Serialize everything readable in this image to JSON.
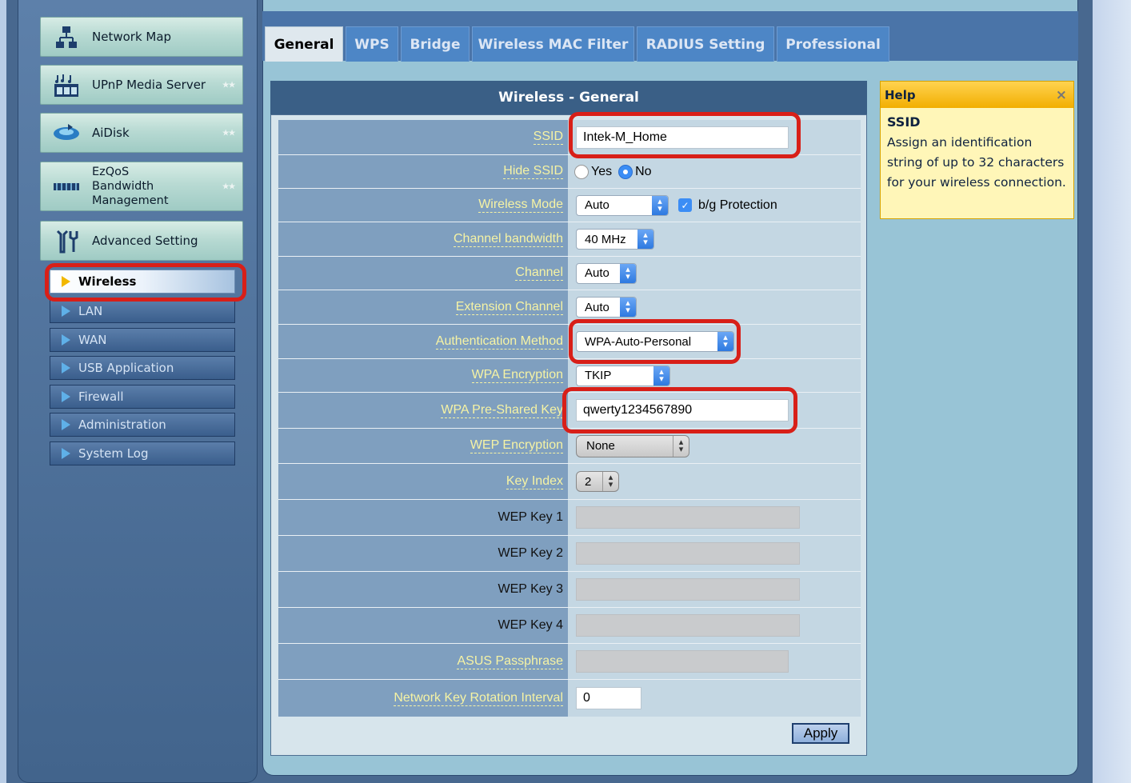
{
  "sidebar": {
    "main_items": [
      {
        "label": "Network Map",
        "icon": "network-map-icon"
      },
      {
        "label": "UPnP Media Server",
        "icon": "media-server-icon"
      },
      {
        "label": "AiDisk",
        "icon": "aidisk-icon"
      },
      {
        "label": "EzQoS\nBandwidth\nManagement",
        "icon": "qos-icon"
      },
      {
        "label": "Advanced Setting",
        "icon": "tools-icon"
      }
    ],
    "sub_items": [
      {
        "label": "Wireless",
        "active": true
      },
      {
        "label": "LAN"
      },
      {
        "label": "WAN"
      },
      {
        "label": "USB Application"
      },
      {
        "label": "Firewall"
      },
      {
        "label": "Administration"
      },
      {
        "label": "System Log"
      }
    ]
  },
  "tabs": [
    "General",
    "WPS",
    "Bridge",
    "Wireless MAC Filter",
    "RADIUS Setting",
    "Professional"
  ],
  "active_tab": "General",
  "form": {
    "title": "Wireless - General",
    "ssid_label": "SSID",
    "ssid_value": "Intek-M_Home",
    "hide_ssid_label": "Hide SSID",
    "hide_ssid_yes": "Yes",
    "hide_ssid_no": "No",
    "hide_ssid_selected": "No",
    "wireless_mode_label": "Wireless Mode",
    "wireless_mode_value": "Auto",
    "bg_protection_label": "b/g Protection",
    "bg_protection_checked": true,
    "channel_bandwidth_label": "Channel bandwidth",
    "channel_bandwidth_value": "40 MHz",
    "channel_label": "Channel",
    "channel_value": "Auto",
    "extension_channel_label": "Extension Channel",
    "extension_channel_value": "Auto",
    "auth_method_label": "Authentication Method",
    "auth_method_value": "WPA-Auto-Personal",
    "wpa_encryption_label": "WPA Encryption",
    "wpa_encryption_value": "TKIP",
    "wpa_psk_label": "WPA Pre-Shared Key",
    "wpa_psk_value": "qwerty1234567890",
    "wep_encryption_label": "WEP Encryption",
    "wep_encryption_value": "None",
    "key_index_label": "Key Index",
    "key_index_value": "2",
    "wep_key1_label": "WEP Key 1",
    "wep_key2_label": "WEP Key 2",
    "wep_key3_label": "WEP Key 3",
    "wep_key4_label": "WEP Key 4",
    "asus_passphrase_label": "ASUS Passphrase",
    "rotation_label": "Network Key Rotation Interval",
    "rotation_value": "0",
    "apply_label": "Apply"
  },
  "help": {
    "header": "Help",
    "close": "×",
    "title": "SSID",
    "body": "Assign an identification string of up to 32 characters for your wireless connection."
  },
  "colors": {
    "highlight": "#d81f18",
    "label_yellow": "#f6f3a4",
    "select_blue": "#3b8df5"
  }
}
